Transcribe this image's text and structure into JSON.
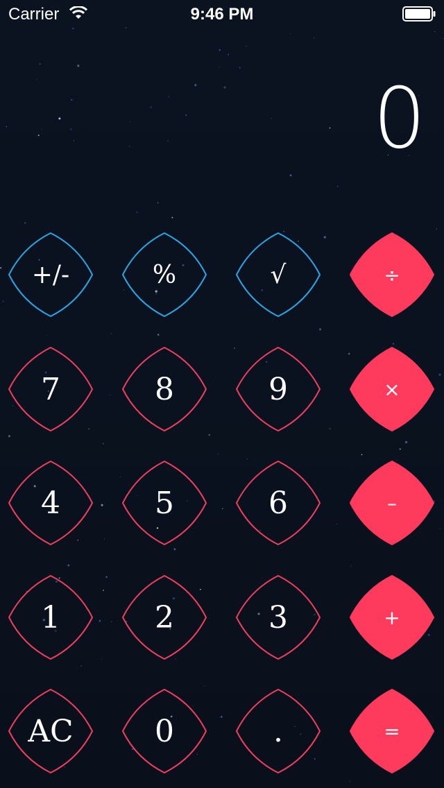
{
  "status_bar": {
    "carrier": "Carrier",
    "time": "9:46 PM"
  },
  "display": {
    "value": "0"
  },
  "colors": {
    "background": "#0a111d",
    "function_outline": "#2aa6e6",
    "digit_outline": "#ee3f5c",
    "operator_fill": "#fe3b5c",
    "text": "#ffffff"
  },
  "keypad": {
    "rows": [
      [
        {
          "label": "+/-",
          "kind": "function",
          "name": "plus-minus-key"
        },
        {
          "label": "%",
          "kind": "function",
          "name": "percent-key"
        },
        {
          "label": "√",
          "kind": "function",
          "name": "square-root-key"
        },
        {
          "label": "÷",
          "kind": "operator",
          "name": "divide-key"
        }
      ],
      [
        {
          "label": "7",
          "kind": "digit",
          "name": "digit-7-key"
        },
        {
          "label": "8",
          "kind": "digit",
          "name": "digit-8-key"
        },
        {
          "label": "9",
          "kind": "digit",
          "name": "digit-9-key"
        },
        {
          "label": "×",
          "kind": "operator",
          "name": "multiply-key"
        }
      ],
      [
        {
          "label": "4",
          "kind": "digit",
          "name": "digit-4-key"
        },
        {
          "label": "5",
          "kind": "digit",
          "name": "digit-5-key"
        },
        {
          "label": "6",
          "kind": "digit",
          "name": "digit-6-key"
        },
        {
          "label": "–",
          "kind": "operator",
          "name": "subtract-key"
        }
      ],
      [
        {
          "label": "1",
          "kind": "digit",
          "name": "digit-1-key"
        },
        {
          "label": "2",
          "kind": "digit",
          "name": "digit-2-key"
        },
        {
          "label": "3",
          "kind": "digit",
          "name": "digit-3-key"
        },
        {
          "label": "+",
          "kind": "operator",
          "name": "add-key"
        }
      ],
      [
        {
          "label": "AC",
          "kind": "digit",
          "name": "all-clear-key"
        },
        {
          "label": "0",
          "kind": "digit",
          "name": "digit-0-key"
        },
        {
          "label": ".",
          "kind": "digit",
          "name": "decimal-point-key"
        },
        {
          "label": "=",
          "kind": "operator",
          "name": "equals-key"
        }
      ]
    ]
  }
}
